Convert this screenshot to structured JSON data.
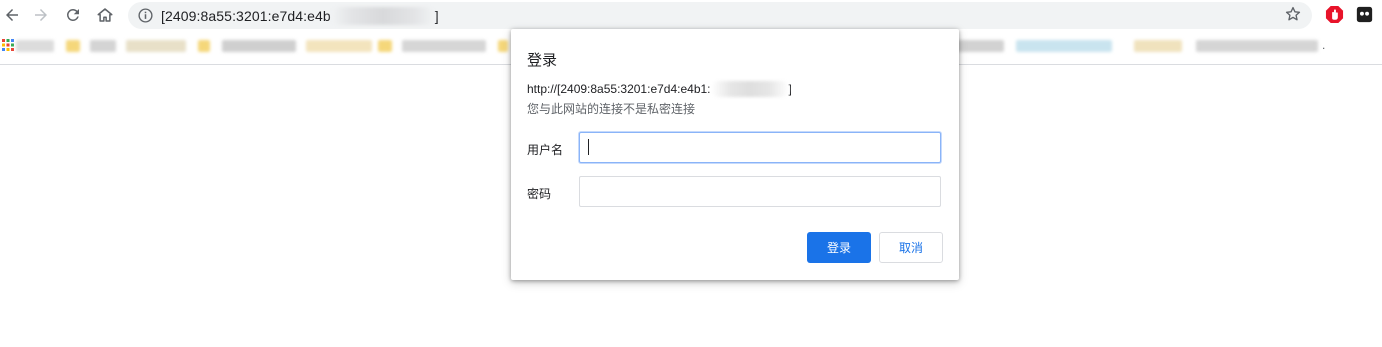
{
  "toolbar": {
    "back_icon": "arrow-left-icon",
    "forward_icon": "arrow-right-icon",
    "reload_icon": "reload-icon",
    "home_icon": "home-icon",
    "url_visible": "[2409:8a55:3201:e7d4:e4b",
    "url_end": "]",
    "bookmark_icon": "star-icon",
    "extensions": [
      "red-shield-extension-icon",
      "dark-extension-icon"
    ]
  },
  "bookmarks_bar": {
    "apps_icon": "apps-grid-icon",
    "trailing_text": "."
  },
  "dialog": {
    "title": "登录",
    "origin_prefix": "http://[2409:8a55:3201:e7d4:e4b1:",
    "origin_suffix": "]",
    "warning": "您与此网站的连接不是私密连接",
    "username_label": "用户名",
    "username_value": "",
    "password_label": "密码",
    "password_value": "",
    "sign_in_button": "登录",
    "cancel_button": "取消"
  },
  "colors": {
    "accent": "#1a73e8",
    "omnibox_bg": "#f1f3f4",
    "focus_border": "#8ab4f8"
  }
}
